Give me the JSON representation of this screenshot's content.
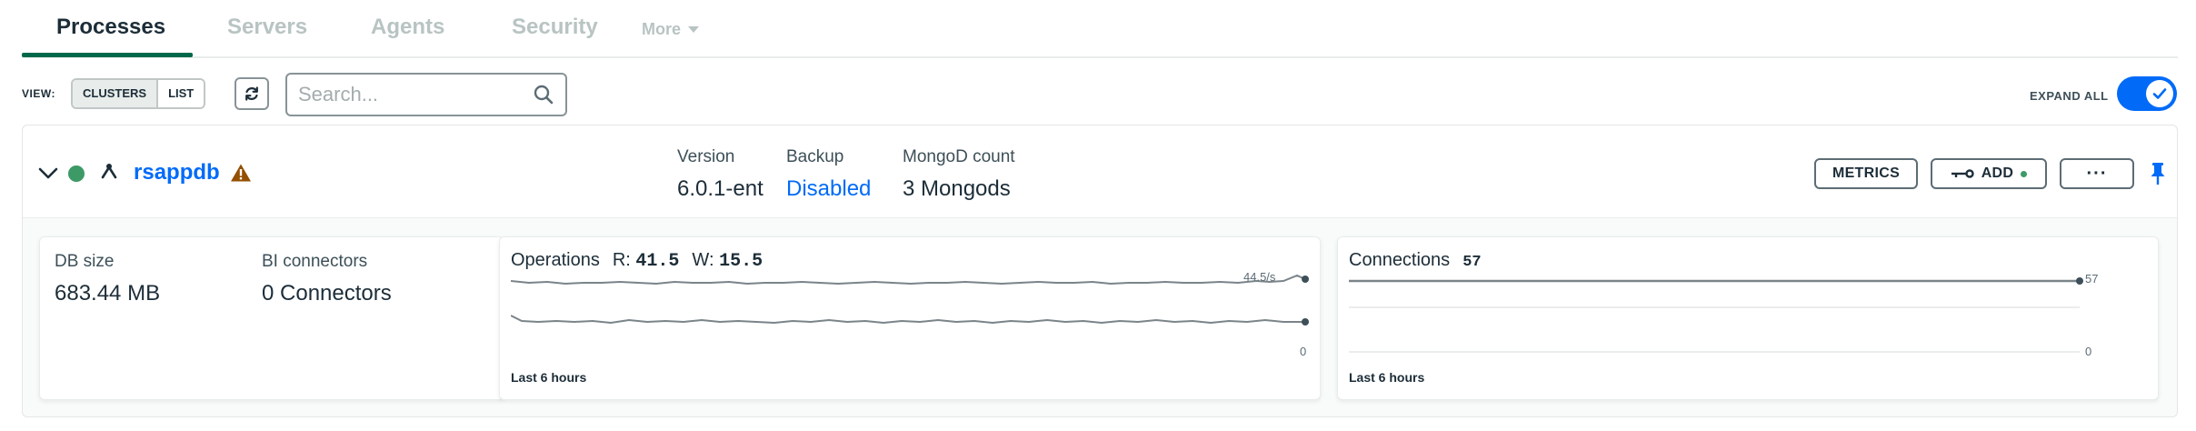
{
  "tabs": [
    {
      "label": "Processes",
      "active": true
    },
    {
      "label": "Servers"
    },
    {
      "label": "Agents"
    },
    {
      "label": "Security"
    }
  ],
  "more_label": "More",
  "toolbar": {
    "view_label": "VIEW:",
    "view_options": [
      "CLUSTERS",
      "LIST"
    ],
    "selected_view": "CLUSTERS",
    "search_placeholder": "Search...",
    "expand_all_label": "EXPAND ALL",
    "expand_all_on": true
  },
  "cluster": {
    "name": "rsappdb",
    "status": "healthy",
    "warning": true,
    "version_label": "Version",
    "version_value": "6.0.1-ent",
    "backup_label": "Backup",
    "backup_value": "Disabled",
    "mongod_label": "MongoD count",
    "mongod_value": "3 Mongods",
    "metrics_button": "METRICS",
    "add_button": "ADD",
    "more_button": "···"
  },
  "stats": {
    "db_size_label": "DB size",
    "db_size_value": "683.44 MB",
    "bi_label": "BI connectors",
    "bi_value": "0 Connectors"
  },
  "operations": {
    "title": "Operations",
    "r_label": "R:",
    "r_value": "41.5",
    "w_label": "W:",
    "w_value": "15.5",
    "max_label": "44.5/s",
    "min_label": "0",
    "range_label": "Last 6 hours"
  },
  "connections": {
    "title": "Connections",
    "value": "57",
    "max_label": "57",
    "min_label": "0",
    "range_label": "Last 6 hours"
  },
  "colors": {
    "accent_green": "#00684a",
    "link_blue": "#016bf8",
    "status_green": "#3d9a66",
    "warning_brown": "#944f01"
  }
}
